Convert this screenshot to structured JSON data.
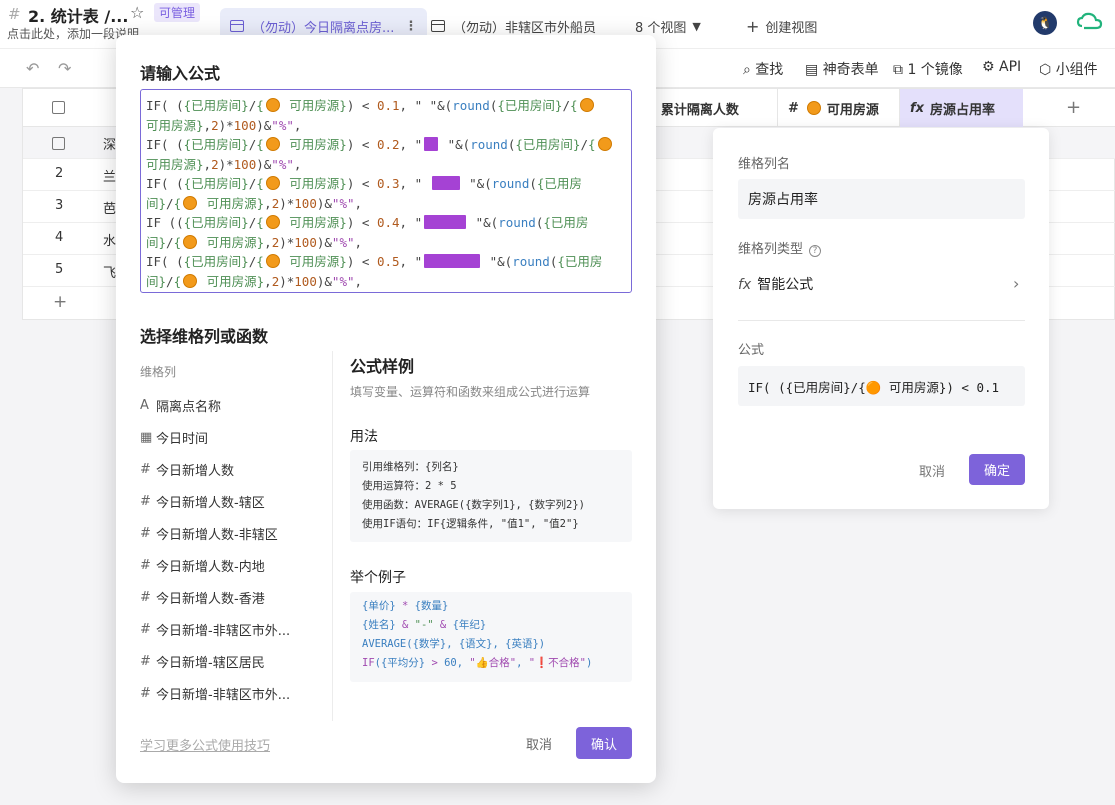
{
  "header": {
    "title": "2. 统计表 /...",
    "badge": "可管理",
    "description": "点击此处，添加一段说明",
    "tabs": [
      {
        "label": "（勿动）今日隔离点房..."
      },
      {
        "label": "（勿动）非辖区市外船员"
      }
    ],
    "views": "8 个视图",
    "create_view": "创建视图"
  },
  "toolbar": {
    "find": "查找",
    "form": "神奇表单",
    "mirror": "1 个镜像",
    "api": "API",
    "widget": "小组件"
  },
  "grid": {
    "columns": [
      "累计隔离人数",
      "可用房源",
      "房源占用率"
    ],
    "row_numbers": [
      "2",
      "3",
      "4",
      "5"
    ],
    "first_cells": [
      "深",
      "兰",
      "芭",
      "水",
      "飞"
    ],
    "add": "+"
  },
  "modal": {
    "title": "请输入公式",
    "section_title": "选择维格列或函数",
    "fields_caption": "维格列",
    "fields": [
      "隔离点名称",
      "今日时间",
      "今日新增人数",
      "今日新增人数-辖区",
      "今日新增人数-非辖区",
      "今日新增人数-内地",
      "今日新增人数-香港",
      "今日新增-非辖区市外...",
      "今日新增-辖区居民",
      "今日新增-非辖区市外..."
    ],
    "example_title": "公式样例",
    "example_sub": "填写变量、运算符和函数来组成公式进行运算",
    "usage_title": "用法",
    "usage_lines": [
      "引用维格列：{列名}",
      "使用运算符：2 * 5",
      "使用函数：AVERAGE({数字列1}, {数字列2})",
      "使用IF语句：IF{逻辑条件, \"值1\", \"值2\"}"
    ],
    "eg_title": "举个例子",
    "learn": "学习更多公式使用技巧",
    "cancel": "取消",
    "confirm": "确认"
  },
  "panel": {
    "name_label": "维格列名",
    "name_value": "房源占用率",
    "type_label": "维格列类型",
    "type_value": "智能公式",
    "formula_label": "公式",
    "formula_value": "IF( ({已用房间}/{🟠 可用房源}) < 0.1",
    "cancel": "取消",
    "ok": "确定"
  }
}
